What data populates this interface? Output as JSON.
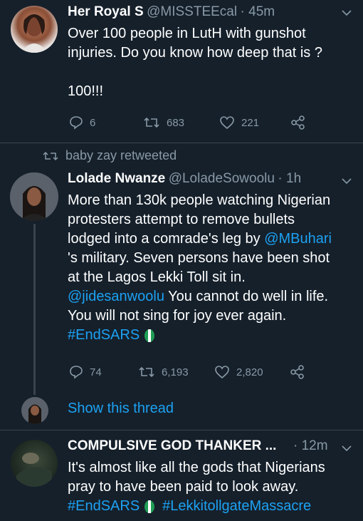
{
  "tweets": [
    {
      "name": "Her Royal S",
      "handle": "@MISSTEEcal",
      "time": "· 45m",
      "lines": [
        "Over 100 people in LutH with gunshot",
        "injuries. Do you know how deep that is ?"
      ],
      "extra": "100!!!",
      "replies": "6",
      "retweets": "683",
      "likes": "221"
    },
    {
      "retweeted_by": "baby zay retweeted",
      "name": "Lolade Nwanze",
      "handle": "@LoladeSowoolu",
      "time": "· 1h",
      "line1": "More than 130k people watching Nigerian",
      "line2": "protesters attempt to remove bullets",
      "line3_pre": "lodged into a comrade's leg by ",
      "mention1": "@MBuhari",
      "line4": "'s military. Seven persons have been shot",
      "line5": "at the Lagos Lekki Toll sit in.",
      "mention2": "@jidesanwoolu",
      "line6_post": " You cannot do well in life.",
      "line7": "You will not sing for joy ever again.",
      "hashtag": "#EndSARS",
      "replies": "74",
      "retweets": "6,193",
      "likes": "2,820",
      "show_thread": "Show this thread"
    },
    {
      "name": "COMPULSIVE GOD THANKER ...",
      "time": "· 12m",
      "line1": "It's almost like all the gods that Nigerians",
      "line2": "pray to have been paid to look away.",
      "hashtag1": "#EndSARS",
      "hashtag2": "#LekkitollgateMassacre"
    }
  ],
  "colors": {
    "background": "#15202b",
    "link": "#1da1f2",
    "muted": "#8899a6",
    "nigeria_green": "#1f9d55"
  },
  "icons": [
    "reply-icon",
    "retweet-icon",
    "like-icon",
    "share-icon",
    "chevron-down-icon",
    "nigeria-flag-icon"
  ]
}
